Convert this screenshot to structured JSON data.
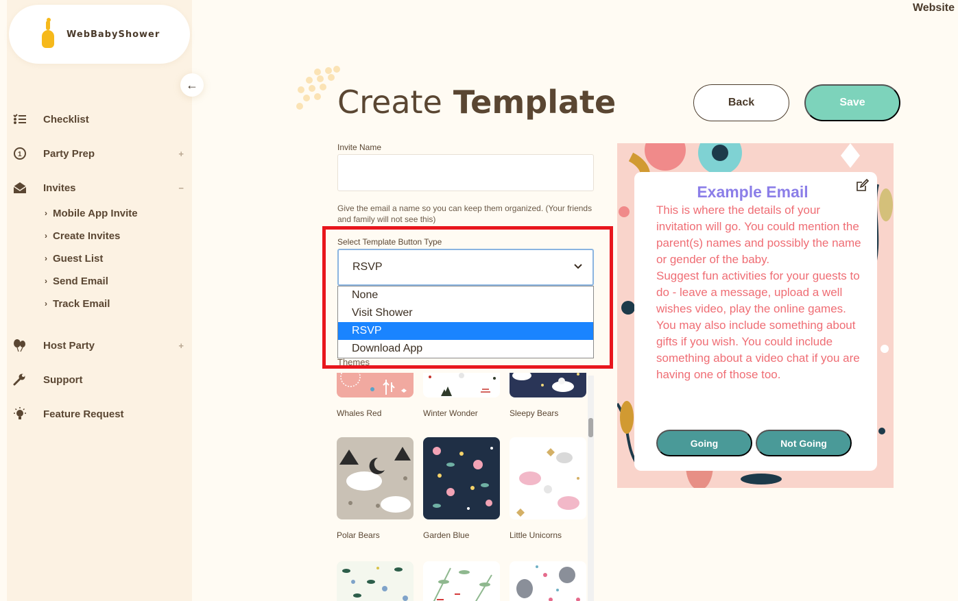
{
  "brand": {
    "name": "WebBabyShower"
  },
  "header": {
    "website_link": "Website"
  },
  "sidebar": {
    "collapse_icon": "arrow-left",
    "items": [
      {
        "label": "Checklist",
        "icon": "list-icon",
        "toggle": ""
      },
      {
        "label": "Party Prep",
        "icon": "clock-one-icon",
        "toggle": "+"
      },
      {
        "label": "Invites",
        "icon": "envelope-icon",
        "toggle": "−"
      },
      {
        "label": "Host Party",
        "icon": "balloons-icon",
        "toggle": "+"
      },
      {
        "label": "Support",
        "icon": "wrench-icon",
        "toggle": ""
      },
      {
        "label": "Feature Request",
        "icon": "lightbulb-icon",
        "toggle": ""
      }
    ],
    "sub_items": [
      {
        "label": "Mobile App Invite"
      },
      {
        "label": "Create Invites"
      },
      {
        "label": "Guest List"
      },
      {
        "label": "Send Email"
      },
      {
        "label": "Track Email"
      }
    ]
  },
  "page": {
    "title_light": "Create",
    "title_bold": "Template",
    "back_label": "Back",
    "save_label": "Save"
  },
  "form": {
    "invite_name_label": "Invite Name",
    "invite_name_value": "",
    "invite_name_hint": "Give the email a name so you can keep them organized. (Your friends and family will not see this)",
    "button_type_label": "Select Template Button Type",
    "button_type_value": "RSVP",
    "button_type_options": [
      "None",
      "Visit Shower",
      "RSVP",
      "Download App"
    ],
    "themes_label": "Themes"
  },
  "themes": [
    {
      "name": "Whales Red",
      "colors": [
        "#f1a9a0",
        "#f7c7c1",
        "#ffffff"
      ]
    },
    {
      "name": "Winter Wonder",
      "colors": [
        "#ffffff",
        "#2f3a2a",
        "#c5322a"
      ]
    },
    {
      "name": "Sleepy Bears",
      "colors": [
        "#2a3557",
        "#ffffff",
        "#f1d87a"
      ]
    },
    {
      "name": "Polar Bears",
      "colors": [
        "#c9c1b5",
        "#ffffff",
        "#2b2b2b"
      ]
    },
    {
      "name": "Garden Blue",
      "colors": [
        "#1f2f45",
        "#f2a3b5",
        "#f5d36a"
      ]
    },
    {
      "name": "Little Unicorns",
      "colors": [
        "#ffffff",
        "#f2b8c8",
        "#d4b066"
      ]
    },
    {
      "name": "",
      "colors": [
        "#f4f7ee",
        "#2d5e4a",
        "#7fa3c9"
      ]
    },
    {
      "name": "",
      "colors": [
        "#ffffff",
        "#8fb88f",
        "#d43a3a"
      ]
    },
    {
      "name": "",
      "colors": [
        "#ffffff",
        "#8a8f99",
        "#e56b8c"
      ]
    }
  ],
  "preview": {
    "title": "Example Email",
    "body": "This is where the details of your invitation will go. You could mention the parent(s) names and possibly the name or gender of the baby.\nSuggest fun activities for your guests to do - leave a message, upload a well wishes video, play the online games. You may also include something about gifts if you wish. You could include something about a video chat if you are having one of those too.",
    "going_label": "Going",
    "not_going_label": "Not Going",
    "edit_icon": "edit-icon"
  },
  "colors": {
    "accent": "#7dd3bb",
    "title_purple": "#8b7ee8",
    "body_coral": "#ef6d74",
    "button_teal": "#4a9a98",
    "highlight_red": "#e8161d"
  }
}
